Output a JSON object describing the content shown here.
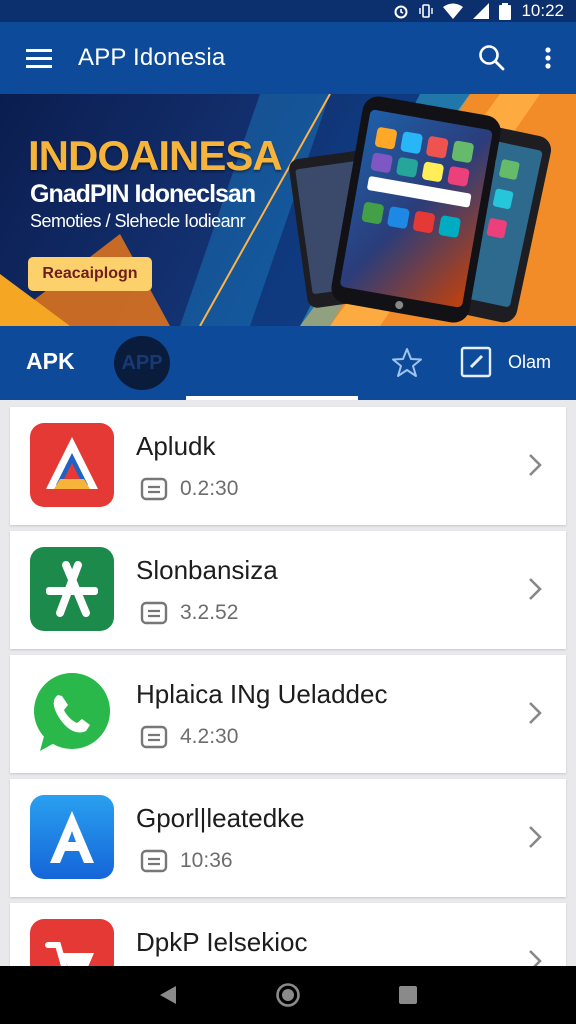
{
  "status_bar": {
    "time": "10:22"
  },
  "app_bar": {
    "title": "APP Idonesia"
  },
  "banner": {
    "title": "INDOAINESA",
    "subtitle": "GnadPIN Idoneclsan",
    "tagline": "Semoties / Slehecle Iodieanr",
    "button_label": "Reacaiplogn"
  },
  "tabs": {
    "apk_label": "APK",
    "app_label": "APP",
    "extra_label": "Olam"
  },
  "apps": [
    {
      "name": "Apludk",
      "meta": "0.2:30",
      "icon": "red-a-logo-icon"
    },
    {
      "name": "Slonbansiza",
      "meta": "3.2.52",
      "icon": "green-store-icon"
    },
    {
      "name": "Hplaica INg Ueladdec",
      "meta": "4.2:30",
      "icon": "whatsapp-phone-icon"
    },
    {
      "name": "Gporl|leatedke",
      "meta": "10:36",
      "icon": "blue-a-icon"
    },
    {
      "name": "DpkP Ielsekioc",
      "meta": "",
      "icon": "red-cart-icon"
    }
  ],
  "colors": {
    "primary": "#0d4a9a",
    "status": "#0c2f6d",
    "banner_title": "#f6b53a",
    "button": "#fcd06b"
  }
}
